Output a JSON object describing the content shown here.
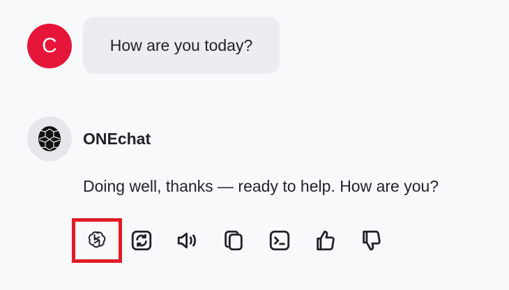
{
  "user_message": {
    "avatar_letter": "C",
    "avatar_color": "#e5163a",
    "text": "How are you today?"
  },
  "bot_message": {
    "name": "ONEchat",
    "avatar_icon": "turtle-shell-logo-icon",
    "text": "Doing well, thanks — ready to help. How are you?"
  },
  "toolbar": {
    "selected": "model-icon",
    "items": [
      {
        "name": "model-icon"
      },
      {
        "name": "regenerate-icon"
      },
      {
        "name": "read-aloud-icon"
      },
      {
        "name": "copy-icon"
      },
      {
        "name": "terminal-icon"
      },
      {
        "name": "thumbs-up-icon"
      },
      {
        "name": "thumbs-down-icon"
      }
    ]
  },
  "colors": {
    "selection_outline": "#e31b23",
    "bubble_bg": "#ebedf0",
    "page_bg": "#f8f9fa"
  }
}
